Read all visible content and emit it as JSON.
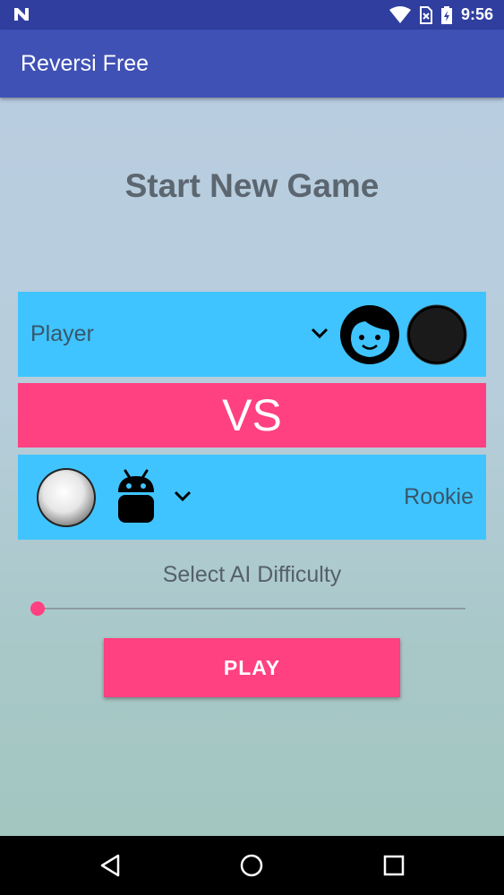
{
  "status_bar": {
    "time": "9:56"
  },
  "app_bar": {
    "title": "Reversi Free"
  },
  "main": {
    "heading": "Start New Game",
    "player": {
      "name": "Player",
      "avatar_icon": "face-icon",
      "disc_color": "black"
    },
    "vs_label": "VS",
    "opponent": {
      "name": "Rookie",
      "avatar_icon": "android-icon",
      "disc_color": "white"
    },
    "difficulty_label": "Select AI Difficulty",
    "difficulty_level": 0,
    "play_label": "PLAY"
  },
  "colors": {
    "primary": "#3f51b5",
    "primary_dark": "#303f9f",
    "accent": "#ff4081",
    "row_blue": "#40c4ff"
  }
}
